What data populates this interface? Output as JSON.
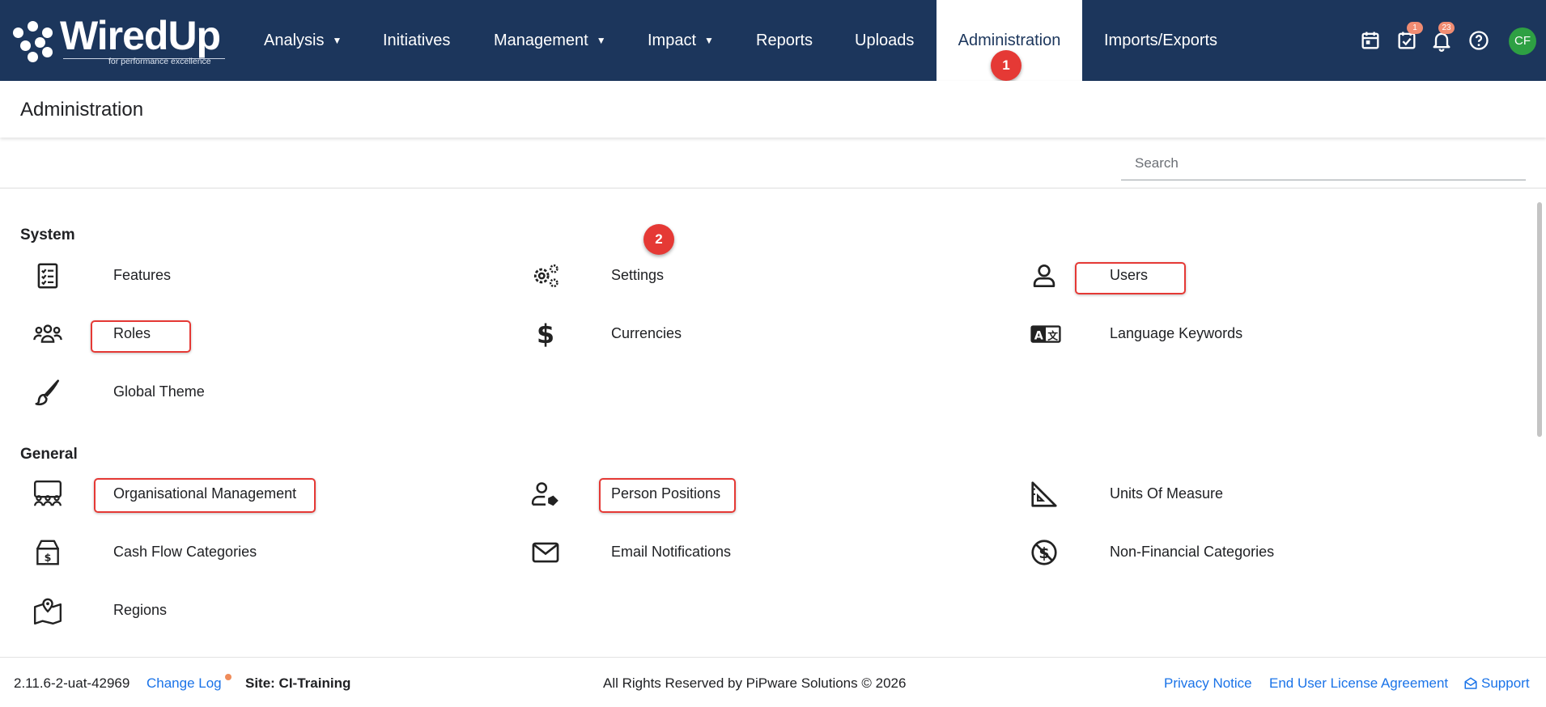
{
  "brand": {
    "name": "WiredUp",
    "tagline": "for performance excellence"
  },
  "nav": {
    "items": [
      {
        "label": "Analysis",
        "caret": "▼"
      },
      {
        "label": "Initiatives"
      },
      {
        "label": "Management",
        "caret": "▼"
      },
      {
        "label": "Impact",
        "caret": "▼"
      },
      {
        "label": "Reports"
      },
      {
        "label": "Uploads"
      },
      {
        "label": "Administration",
        "active": true
      },
      {
        "label": "Imports/Exports"
      }
    ],
    "icons": [
      {
        "name": "calendar-icon"
      },
      {
        "name": "tasks-check-icon",
        "count": "1"
      },
      {
        "name": "bell-icon",
        "count": "23"
      },
      {
        "name": "help-icon"
      }
    ],
    "avatar_initials": "CF",
    "avatar_color": "#2ea043",
    "nav_bg": "#1c365c"
  },
  "annotations": {
    "step1": "1",
    "step2": "2",
    "color": "#e53935"
  },
  "page": {
    "title": "Administration"
  },
  "search": {
    "placeholder": "Search"
  },
  "sections": {
    "system": {
      "title": "System",
      "items": [
        {
          "label": "Features",
          "icon": "checklist-icon"
        },
        {
          "label": "Settings",
          "icon": "gears-icon"
        },
        {
          "label": "Users",
          "icon": "user-icon",
          "highlighted": true
        },
        {
          "label": "Roles",
          "icon": "group-icon",
          "highlighted": true
        },
        {
          "label": "Currencies",
          "icon": "dollar-icon"
        },
        {
          "label": "Language Keywords",
          "icon": "language-icon"
        },
        {
          "label": "Global Theme",
          "icon": "brush-icon"
        }
      ]
    },
    "general": {
      "title": "General",
      "items": [
        {
          "label": "Organisational Management",
          "icon": "org-icon",
          "highlighted": true
        },
        {
          "label": "Person Positions",
          "icon": "person-tag-icon",
          "highlighted": true
        },
        {
          "label": "Units Of Measure",
          "icon": "ruler-triangle-icon"
        },
        {
          "label": "Cash Flow Categories",
          "icon": "cash-box-icon"
        },
        {
          "label": "Email Notifications",
          "icon": "email-icon"
        },
        {
          "label": "Non-Financial Categories",
          "icon": "no-dollar-icon"
        },
        {
          "label": "Regions",
          "icon": "map-pin-icon"
        }
      ]
    }
  },
  "footer": {
    "version": "2.11.6-2-uat-42969",
    "change_log": "Change Log",
    "site": "Site: CI-Training",
    "copyright": "All Rights Reserved by PiPware Solutions © 2026",
    "privacy": "Privacy Notice",
    "eula": "End User License Agreement",
    "support": "Support"
  }
}
